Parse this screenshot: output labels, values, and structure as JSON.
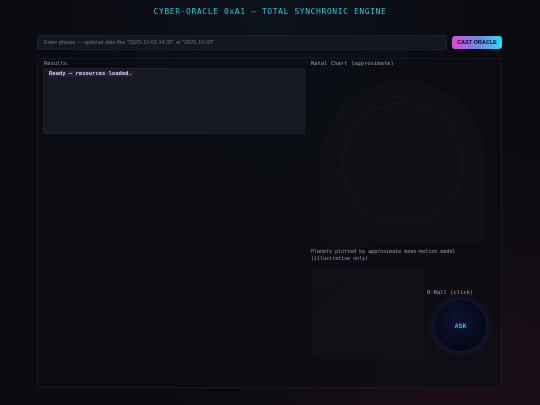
{
  "app": {
    "title": "CYBER-ORACLE 0xA1 — TOTAL SYNCHRONIC ENGINE"
  },
  "query": {
    "placeholder": "Enter phrase — optional date like \"2025-10-03 14:30\" or \"2025-10-03\"",
    "cast_label": "CAST ORACLE"
  },
  "results": {
    "heading": "Results",
    "status": "Ready — resources loaded."
  },
  "natal": {
    "heading": "Natal Chart (approximate)",
    "note": "Planets plotted by approximate mean-motion model (illustrative only)"
  },
  "eightball": {
    "heading": "8-Ball (click)",
    "ask_label": "ASK"
  },
  "colors": {
    "accent": "#2ec8d8",
    "background": "#0a0b10",
    "button_gradient_start": "#e04ad8",
    "button_gradient_end": "#2edcf0"
  }
}
